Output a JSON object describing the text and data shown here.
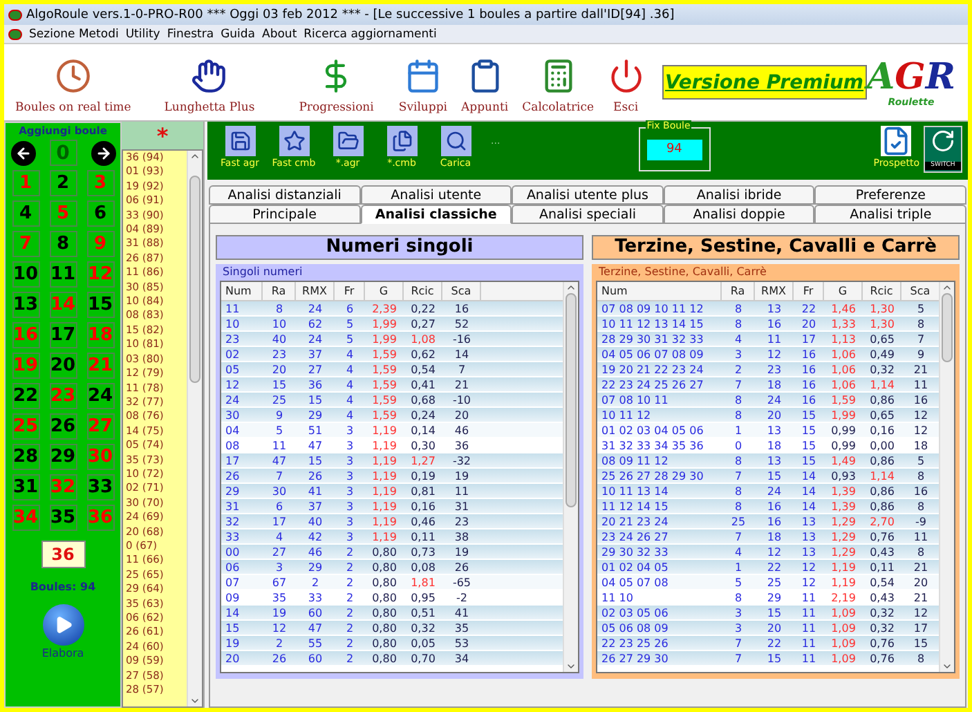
{
  "window": {
    "title": "AlgoRoule vers.1-0-PRO-R00  ***  Oggi 03 feb 2012  ***   - [Le successive 1 boules a partire dall'ID[94] .36]"
  },
  "menu": [
    "Sezione Metodi",
    "Utility",
    "Finestra",
    "Guida",
    "About",
    "Ricerca aggiornamenti"
  ],
  "toolbar": [
    {
      "kind": "clock",
      "label": "Boules on real time"
    },
    {
      "kind": "hand",
      "label": "Lunghetta Plus"
    },
    {
      "kind": "dollar",
      "label": "Progressioni"
    },
    {
      "kind": "calendar",
      "label": "Sviluppi"
    },
    {
      "kind": "clipboard",
      "label": "Appunti"
    },
    {
      "kind": "calculator",
      "label": "Calcolatrice"
    },
    {
      "kind": "power",
      "label": "Esci"
    }
  ],
  "premium": "Versione Premium",
  "logo": {
    "letters": [
      "A",
      "G",
      "R"
    ],
    "caption": "Roulette"
  },
  "board": {
    "title": "Aggiungi boule",
    "zero": "0",
    "numbers": [
      {
        "n": "1",
        "color": "#ff0000"
      },
      {
        "n": "2",
        "color": "#000000"
      },
      {
        "n": "3",
        "color": "#ff0000"
      },
      {
        "n": "4",
        "color": "#000000"
      },
      {
        "n": "5",
        "color": "#ff0000"
      },
      {
        "n": "6",
        "color": "#000000"
      },
      {
        "n": "7",
        "color": "#ff0000"
      },
      {
        "n": "8",
        "color": "#000000"
      },
      {
        "n": "9",
        "color": "#ff0000"
      },
      {
        "n": "10",
        "color": "#000000"
      },
      {
        "n": "11",
        "color": "#000000"
      },
      {
        "n": "12",
        "color": "#ff0000"
      },
      {
        "n": "13",
        "color": "#000000"
      },
      {
        "n": "14",
        "color": "#ff0000"
      },
      {
        "n": "15",
        "color": "#000000"
      },
      {
        "n": "16",
        "color": "#ff0000"
      },
      {
        "n": "17",
        "color": "#000000"
      },
      {
        "n": "18",
        "color": "#ff0000"
      },
      {
        "n": "19",
        "color": "#ff0000"
      },
      {
        "n": "20",
        "color": "#000000"
      },
      {
        "n": "21",
        "color": "#ff0000"
      },
      {
        "n": "22",
        "color": "#000000"
      },
      {
        "n": "23",
        "color": "#ff0000"
      },
      {
        "n": "24",
        "color": "#000000"
      },
      {
        "n": "25",
        "color": "#ff0000"
      },
      {
        "n": "26",
        "color": "#000000"
      },
      {
        "n": "27",
        "color": "#ff0000"
      },
      {
        "n": "28",
        "color": "#000000"
      },
      {
        "n": "29",
        "color": "#000000"
      },
      {
        "n": "30",
        "color": "#ff0000"
      },
      {
        "n": "31",
        "color": "#000000"
      },
      {
        "n": "32",
        "color": "#ff0000"
      },
      {
        "n": "33",
        "color": "#000000"
      },
      {
        "n": "34",
        "color": "#ff0000"
      },
      {
        "n": "35",
        "color": "#000000"
      },
      {
        "n": "36",
        "color": "#ff0000"
      }
    ],
    "current": "36",
    "count": "Boules: 94",
    "run": "Elabora"
  },
  "history": {
    "header": "*",
    "items": [
      "36 (94)",
      "01 (93)",
      "19 (92)",
      "06 (91)",
      "33 (90)",
      "04 (89)",
      "31 (88)",
      "26 (87)",
      "11 (86)",
      "30 (85)",
      "10 (84)",
      "08 (83)",
      "15 (82)",
      "10 (81)",
      "03 (80)",
      "12 (79)",
      "11 (78)",
      "32 (77)",
      "08 (76)",
      "14 (75)",
      "05 (74)",
      "35 (73)",
      "10 (72)",
      "02 (71)",
      "30 (70)",
      "24 (69)",
      "20 (68)",
      "0 (67)",
      "11 (66)",
      "25 (65)",
      "29 (64)",
      "35 (63)",
      "06 (62)",
      "26 (61)",
      "24 (60)",
      "09 (59)",
      "27 (58)",
      "28 (57)"
    ]
  },
  "actions": [
    {
      "kind": "save-arrow",
      "label": "Fast agr"
    },
    {
      "kind": "save-star",
      "label": "Fast cmb"
    },
    {
      "kind": "folder",
      "label": "*.agr"
    },
    {
      "kind": "pages",
      "label": "*.cmb"
    },
    {
      "kind": "load",
      "label": "Carica"
    }
  ],
  "more": "...",
  "fix_boule": {
    "label": "Fix Boule",
    "value": "94"
  },
  "report": "Prospetto",
  "switch": "SWITCH",
  "tabs_back": [
    {
      "label": "Analisi distanziali",
      "selected": false
    },
    {
      "label": "Analisi utente",
      "selected": false
    },
    {
      "label": "Analisi utente plus",
      "selected": false
    },
    {
      "label": "Analisi ibride",
      "selected": false
    },
    {
      "label": "Preferenze",
      "selected": false
    }
  ],
  "tabs_front": [
    {
      "label": "Principale",
      "selected": false
    },
    {
      "label": "Analisi classiche",
      "selected": true
    },
    {
      "label": "Analisi speciali",
      "selected": false
    },
    {
      "label": "Analisi doppie",
      "selected": false
    },
    {
      "label": "Analisi triple",
      "selected": false
    }
  ],
  "panels": [
    {
      "heading": "Numeri singoli",
      "group": "Singoli numeri",
      "columns": [
        "Num",
        "Ra",
        "RMX",
        "Fr",
        "G",
        "Rcic",
        "Sca"
      ],
      "rows": [
        {
          "cells": [
            "11",
            "8",
            "24",
            "6",
            "2,39",
            "0,22",
            "16"
          ],
          "g_high": true,
          "rcic_high": false
        },
        {
          "cells": [
            "10",
            "10",
            "62",
            "5",
            "1,99",
            "0,27",
            "52"
          ],
          "g_high": true,
          "rcic_high": false
        },
        {
          "cells": [
            "23",
            "40",
            "24",
            "5",
            "1,99",
            "1,08",
            "-16"
          ],
          "g_high": true,
          "rcic_high": true
        },
        {
          "cells": [
            "02",
            "23",
            "37",
            "4",
            "1,59",
            "0,62",
            "14"
          ],
          "g_high": true,
          "rcic_high": false
        },
        {
          "cells": [
            "05",
            "20",
            "27",
            "4",
            "1,59",
            "0,54",
            "7"
          ],
          "g_high": true,
          "rcic_high": false
        },
        {
          "cells": [
            "12",
            "15",
            "36",
            "4",
            "1,59",
            "0,41",
            "21"
          ],
          "g_high": true,
          "rcic_high": false
        },
        {
          "cells": [
            "24",
            "25",
            "15",
            "4",
            "1,59",
            "0,68",
            "-10"
          ],
          "g_high": true,
          "rcic_high": false
        },
        {
          "cells": [
            "30",
            "9",
            "29",
            "4",
            "1,59",
            "0,24",
            "20"
          ],
          "g_high": true,
          "rcic_high": false
        },
        {
          "cells": [
            "04",
            "5",
            "51",
            "3",
            "1,19",
            "0,14",
            "46"
          ],
          "g_high": true,
          "rcic_high": false
        },
        {
          "cells": [
            "08",
            "11",
            "47",
            "3",
            "1,19",
            "0,30",
            "36"
          ],
          "g_high": true,
          "rcic_high": false
        },
        {
          "cells": [
            "17",
            "47",
            "15",
            "3",
            "1,19",
            "1,27",
            "-32"
          ],
          "g_high": true,
          "rcic_high": true
        },
        {
          "cells": [
            "26",
            "7",
            "26",
            "3",
            "1,19",
            "0,19",
            "19"
          ],
          "g_high": true,
          "rcic_high": false
        },
        {
          "cells": [
            "29",
            "30",
            "41",
            "3",
            "1,19",
            "0,81",
            "11"
          ],
          "g_high": true,
          "rcic_high": false
        },
        {
          "cells": [
            "31",
            "6",
            "37",
            "3",
            "1,19",
            "0,16",
            "31"
          ],
          "g_high": true,
          "rcic_high": false
        },
        {
          "cells": [
            "32",
            "17",
            "40",
            "3",
            "1,19",
            "0,46",
            "23"
          ],
          "g_high": true,
          "rcic_high": false
        },
        {
          "cells": [
            "33",
            "4",
            "42",
            "3",
            "1,19",
            "0,11",
            "38"
          ],
          "g_high": true,
          "rcic_high": false
        },
        {
          "cells": [
            "00",
            "27",
            "46",
            "2",
            "0,80",
            "0,73",
            "19"
          ],
          "g_high": false,
          "rcic_high": false
        },
        {
          "cells": [
            "06",
            "3",
            "29",
            "2",
            "0,80",
            "0,08",
            "26"
          ],
          "g_high": false,
          "rcic_high": false
        },
        {
          "cells": [
            "07",
            "67",
            "2",
            "2",
            "0,80",
            "1,81",
            "-65"
          ],
          "g_high": false,
          "rcic_high": true
        },
        {
          "cells": [
            "09",
            "35",
            "33",
            "2",
            "0,80",
            "0,95",
            "-2"
          ],
          "g_high": false,
          "rcic_high": false
        },
        {
          "cells": [
            "14",
            "19",
            "60",
            "2",
            "0,80",
            "0,51",
            "41"
          ],
          "g_high": false,
          "rcic_high": false
        },
        {
          "cells": [
            "15",
            "12",
            "47",
            "2",
            "0,80",
            "0,32",
            "35"
          ],
          "g_high": false,
          "rcic_high": false
        },
        {
          "cells": [
            "19",
            "2",
            "55",
            "2",
            "0,80",
            "0,05",
            "53"
          ],
          "g_high": false,
          "rcic_high": false
        },
        {
          "cells": [
            "20",
            "26",
            "60",
            "2",
            "0,80",
            "0,70",
            "34"
          ],
          "g_high": false,
          "rcic_high": false
        }
      ]
    },
    {
      "heading": "Terzine, Sestine, Cavalli e Carrè",
      "group": "Terzine, Sestine, Cavalli, Carrè",
      "columns": [
        "Num",
        "Ra",
        "RMX",
        "Fr",
        "G",
        "Rcic",
        "Sca"
      ],
      "rows": [
        {
          "cells": [
            "07 08 09 10 11 12",
            "8",
            "13",
            "22",
            "1,46",
            "1,30",
            "5"
          ],
          "g_high": true,
          "rcic_high": true
        },
        {
          "cells": [
            "10 11 12 13 14 15",
            "8",
            "16",
            "20",
            "1,33",
            "1,30",
            "8"
          ],
          "g_high": true,
          "rcic_high": true
        },
        {
          "cells": [
            "28 29 30 31 32 33",
            "4",
            "11",
            "17",
            "1,13",
            "0,65",
            "7"
          ],
          "g_high": true,
          "rcic_high": false
        },
        {
          "cells": [
            "04 05 06 07 08 09",
            "3",
            "12",
            "16",
            "1,06",
            "0,49",
            "9"
          ],
          "g_high": true,
          "rcic_high": false
        },
        {
          "cells": [
            "19 20 21 22 23 24",
            "2",
            "23",
            "16",
            "1,06",
            "0,32",
            "21"
          ],
          "g_high": true,
          "rcic_high": false
        },
        {
          "cells": [
            "22 23 24 25 26 27",
            "7",
            "18",
            "16",
            "1,06",
            "1,14",
            "11"
          ],
          "g_high": true,
          "rcic_high": true
        },
        {
          "cells": [
            "07 08 10 11",
            "8",
            "24",
            "16",
            "1,59",
            "0,86",
            "16"
          ],
          "g_high": true,
          "rcic_high": false
        },
        {
          "cells": [
            "10 11 12",
            "8",
            "20",
            "15",
            "1,99",
            "0,65",
            "12"
          ],
          "g_high": true,
          "rcic_high": false
        },
        {
          "cells": [
            "01 02 03 04 05 06",
            "1",
            "13",
            "15",
            "0,99",
            "0,16",
            "12"
          ],
          "g_high": false,
          "rcic_high": false
        },
        {
          "cells": [
            "31 32 33 34 35 36",
            "0",
            "18",
            "15",
            "0,99",
            "0,00",
            "18"
          ],
          "g_high": false,
          "rcic_high": false
        },
        {
          "cells": [
            "08 09 11 12",
            "8",
            "13",
            "15",
            "1,49",
            "0,86",
            "5"
          ],
          "g_high": true,
          "rcic_high": false
        },
        {
          "cells": [
            "25 26 27 28 29 30",
            "7",
            "15",
            "14",
            "0,93",
            "1,14",
            "8"
          ],
          "g_high": false,
          "rcic_high": true
        },
        {
          "cells": [
            "10 11 13 14",
            "8",
            "24",
            "14",
            "1,39",
            "0,86",
            "16"
          ],
          "g_high": true,
          "rcic_high": false
        },
        {
          "cells": [
            "11 12 14 15",
            "8",
            "16",
            "14",
            "1,39",
            "0,86",
            "8"
          ],
          "g_high": true,
          "rcic_high": false
        },
        {
          "cells": [
            "20 21 23 24",
            "25",
            "16",
            "13",
            "1,29",
            "2,70",
            "-9"
          ],
          "g_high": true,
          "rcic_high": true
        },
        {
          "cells": [
            "23 24 26 27",
            "7",
            "18",
            "13",
            "1,29",
            "0,76",
            "11"
          ],
          "g_high": true,
          "rcic_high": false
        },
        {
          "cells": [
            "29 30 32 33",
            "4",
            "12",
            "13",
            "1,29",
            "0,43",
            "8"
          ],
          "g_high": true,
          "rcic_high": false
        },
        {
          "cells": [
            "01 02 04 05",
            "1",
            "22",
            "12",
            "1,19",
            "0,11",
            "21"
          ],
          "g_high": true,
          "rcic_high": false
        },
        {
          "cells": [
            "04 05 07 08",
            "5",
            "25",
            "12",
            "1,19",
            "0,54",
            "20"
          ],
          "g_high": true,
          "rcic_high": false
        },
        {
          "cells": [
            "11 10",
            "8",
            "29",
            "11",
            "2,19",
            "0,43",
            "21"
          ],
          "g_high": true,
          "rcic_high": false
        },
        {
          "cells": [
            "02 03 05 06",
            "3",
            "15",
            "11",
            "1,09",
            "0,32",
            "12"
          ],
          "g_high": true,
          "rcic_high": false
        },
        {
          "cells": [
            "05 06 08 09",
            "3",
            "20",
            "11",
            "1,09",
            "0,32",
            "17"
          ],
          "g_high": true,
          "rcic_high": false
        },
        {
          "cells": [
            "22 23 25 26",
            "7",
            "22",
            "11",
            "1,09",
            "0,76",
            "15"
          ],
          "g_high": true,
          "rcic_high": false
        },
        {
          "cells": [
            "26 27 29 30",
            "7",
            "15",
            "11",
            "1,09",
            "0,76",
            "8"
          ],
          "g_high": true,
          "rcic_high": false
        }
      ]
    }
  ]
}
